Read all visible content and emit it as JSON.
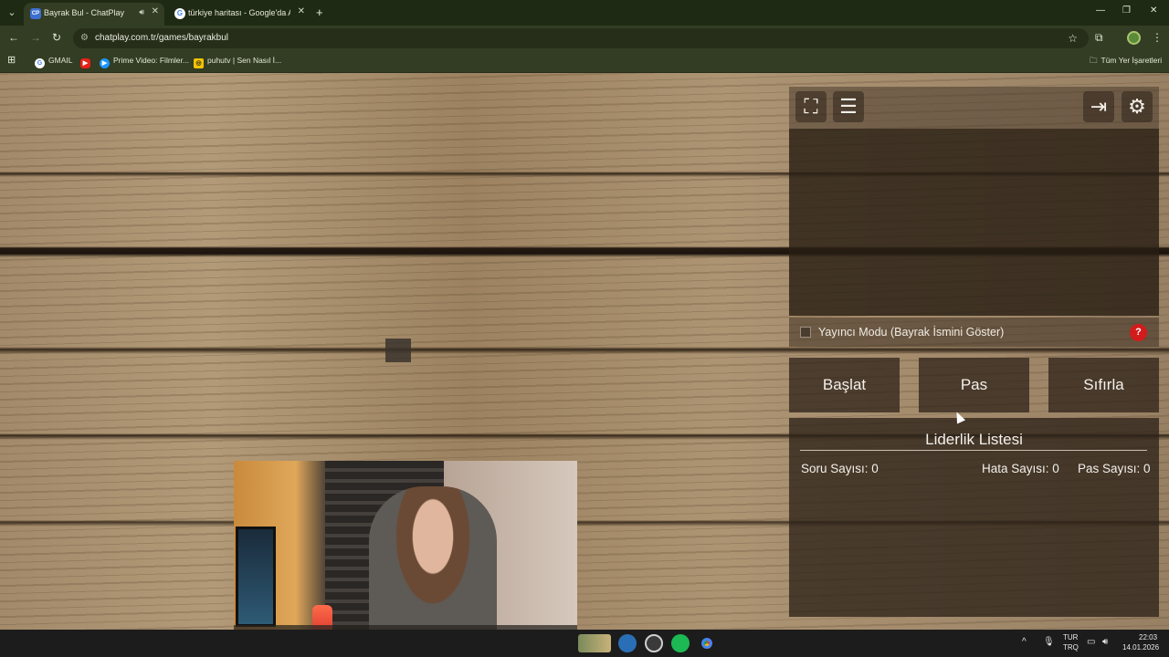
{
  "browser": {
    "tabs": [
      {
        "title": "Bayrak Bul - ChatPlay",
        "favicon": "CP",
        "active": true
      },
      {
        "title": "türkiye haritası - Google'da Ara",
        "favicon": "G",
        "active": false
      }
    ],
    "url": "chatplay.com.tr/games/bayrakbul",
    "bookmarks": [
      {
        "label": "GMAIL",
        "icon": "google-icon"
      },
      {
        "label": "",
        "icon": "youtube-icon"
      },
      {
        "label": "Prime Video: Filmler...",
        "icon": "prime-video-icon"
      },
      {
        "label": "puhutv | Sen Nasıl İ...",
        "icon": "puhutv-icon"
      }
    ],
    "all_bookmarks_label": "Tüm Yer İşaretleri"
  },
  "game": {
    "streamer_mode_label": "Yayıncı Modu (Bayrak İsmini Göster)",
    "streamer_mode_checked": false,
    "help_label": "?",
    "buttons": {
      "start": "Başlat",
      "pass": "Pas",
      "reset": "Sıfırla"
    },
    "leaderboard": {
      "title": "Liderlik Listesi",
      "question_count": "Soru Sayısı: 0",
      "error_count": "Hata Sayısı: 0",
      "pass_count": "Pas Sayısı: 0"
    }
  },
  "taskbar": {
    "lang_top": "TUR",
    "lang_bottom": "TRQ",
    "time": "22:03",
    "date": "14.01.2026"
  }
}
